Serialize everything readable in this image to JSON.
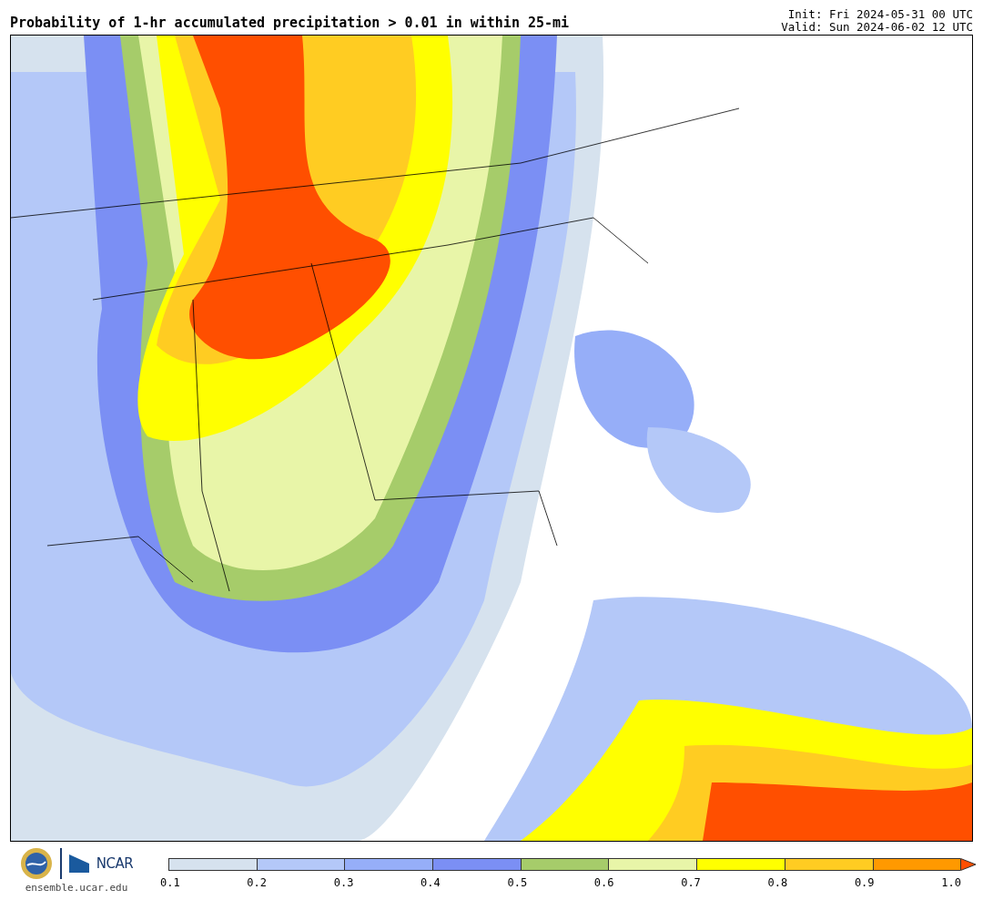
{
  "title": "Probability of 1-hr accumulated precipitation > 0.01 in within 25-mi",
  "init": "Init: Fri 2024-05-31 00 UTC",
  "valid": "Valid: Sun 2024-06-02 12 UTC",
  "logo": {
    "text": "NCAR",
    "url": "ensemble.ucar.edu"
  },
  "colorbar": {
    "segments": [
      {
        "color": "#d6e2ee"
      },
      {
        "color": "#b4c8f8"
      },
      {
        "color": "#96aef8"
      },
      {
        "color": "#7b8ff4"
      },
      {
        "color": "#a6cc6a"
      },
      {
        "color": "#e8f5a8"
      },
      {
        "color": "#ffff00"
      },
      {
        "color": "#ffcc22"
      },
      {
        "color": "#ff9900"
      }
    ],
    "extend": {
      "color": "#ff4f00"
    },
    "ticks": [
      "0.1",
      "0.2",
      "0.3",
      "0.4",
      "0.5",
      "0.6",
      "0.7",
      "0.8",
      "0.9",
      "1.0"
    ]
  }
}
